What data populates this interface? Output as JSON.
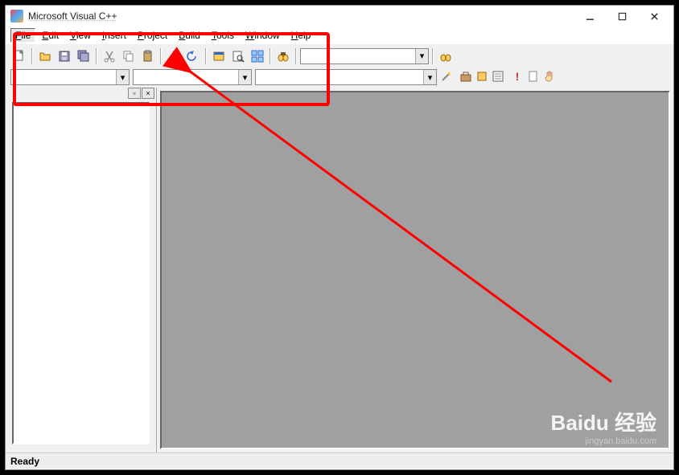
{
  "window": {
    "title": "Microsoft Visual C++"
  },
  "menu": {
    "items": [
      {
        "label": "File",
        "hot": "F"
      },
      {
        "label": "Edit",
        "hot": "E"
      },
      {
        "label": "View",
        "hot": "V"
      },
      {
        "label": "Insert",
        "hot": "I"
      },
      {
        "label": "Project",
        "hot": "P"
      },
      {
        "label": "Build",
        "hot": "B"
      },
      {
        "label": "Tools",
        "hot": "T"
      },
      {
        "label": "Window",
        "hot": "W"
      },
      {
        "label": "Help",
        "hot": "H"
      }
    ]
  },
  "toolbar1": {
    "combo_value": ""
  },
  "toolbar2": {
    "combo1_value": "",
    "combo2_value": ""
  },
  "status": {
    "text": "Ready"
  },
  "watermark": {
    "main": "Baidu 经验",
    "sub": "jingyan.baidu.com"
  },
  "icons": {
    "new": "new-file-icon",
    "open": "open-folder-icon",
    "save": "save-icon",
    "saveall": "save-all-icon",
    "cut": "cut-icon",
    "copy": "copy-icon",
    "paste": "paste-icon",
    "undo": "undo-icon",
    "redo": "redo-icon",
    "win1": "window-list-icon",
    "win2": "find-in-files-icon",
    "win3": "tile-windows-icon",
    "find": "find-icon",
    "search": "binoculars-icon",
    "wizard": "wizard-icon",
    "tool1": "toolbox-icon",
    "tool2": "resource-icon",
    "tool3": "properties-icon",
    "tool4": "exclaim-icon",
    "tool5": "output-icon",
    "tool6": "hand-icon"
  }
}
